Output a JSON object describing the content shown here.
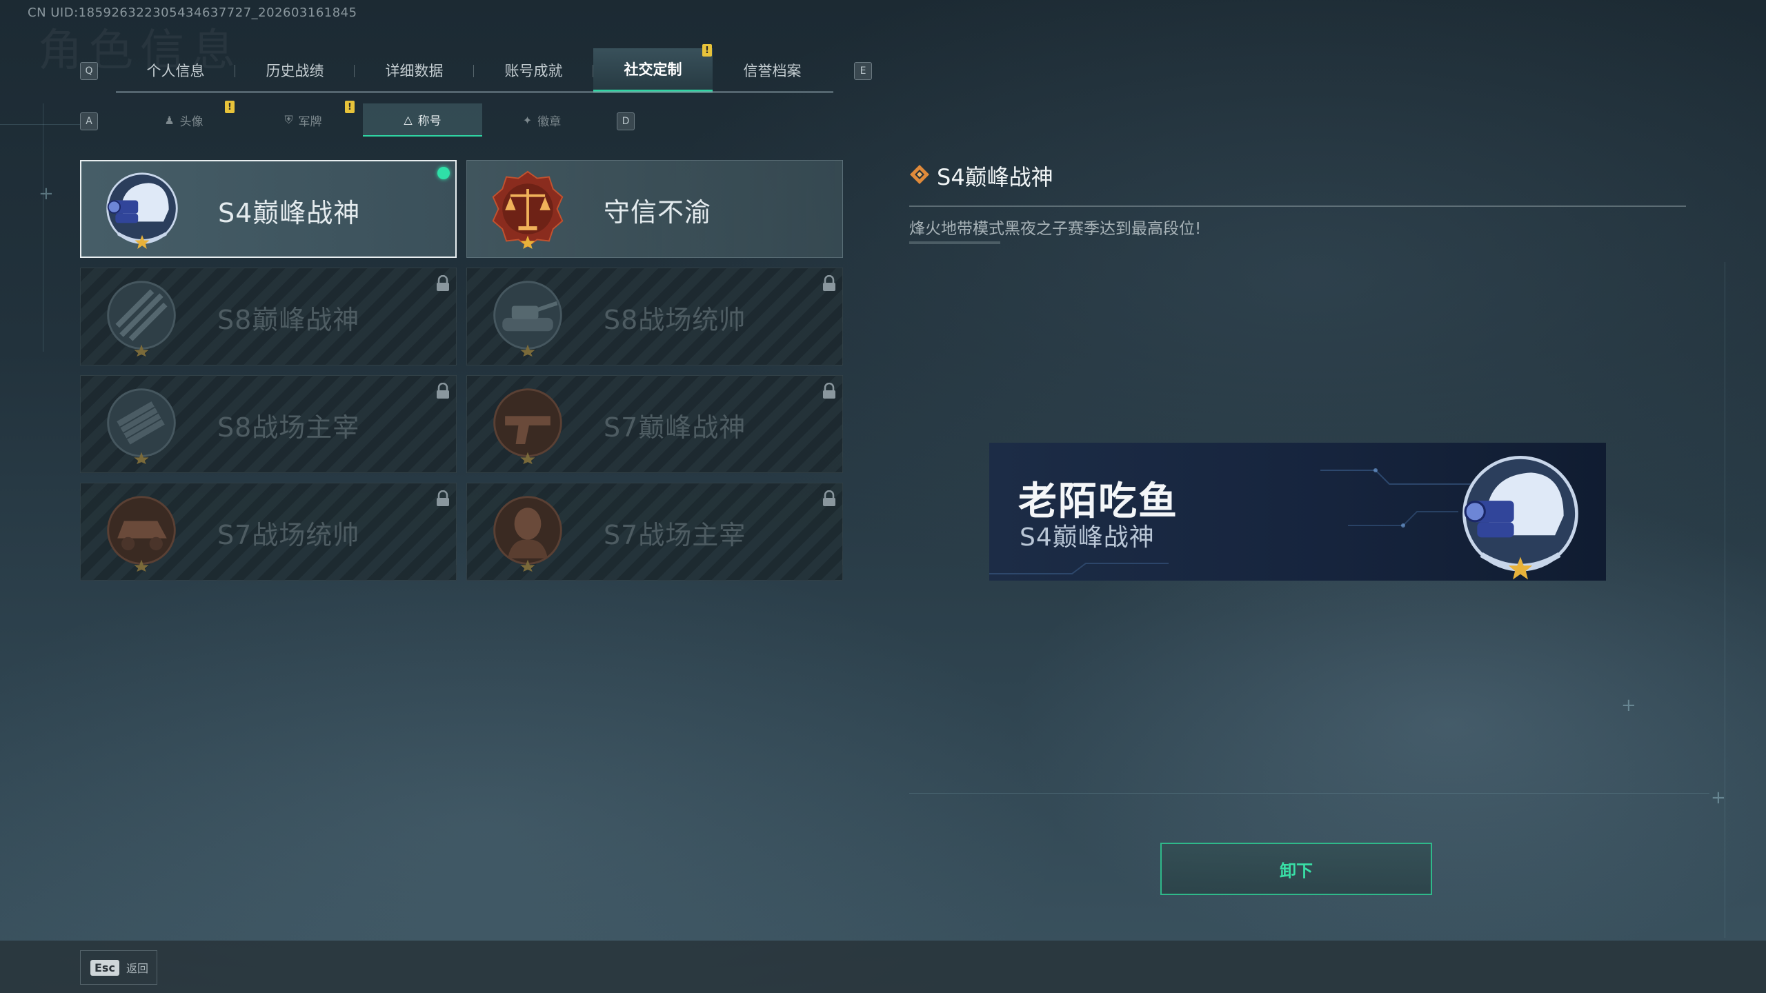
{
  "uid_text": "CN UID:185926322305434637727_202603161845",
  "page_bg_title": "角色信息",
  "keys": {
    "prev_main": "Q",
    "next_main": "E",
    "prev_sub": "A",
    "next_sub": "D"
  },
  "main_tabs": [
    "个人信息",
    "历史战绩",
    "详细数据",
    "账号成就",
    "社交定制",
    "信誉档案"
  ],
  "main_tab_active": "社交定制",
  "sub_tabs": [
    "头像",
    "军牌",
    "称号",
    "徽章"
  ],
  "sub_tab_active": "称号",
  "alert_mark": "!",
  "titles": [
    {
      "name": "S4巅峰战神",
      "state": "selected",
      "equipped": true,
      "badge": "helmet-nightvision"
    },
    {
      "name": "守信不渝",
      "state": "unlocked",
      "badge": "scales-of-justice"
    },
    {
      "name": "S8巅峰战神",
      "state": "locked",
      "badge": "crossed-blades"
    },
    {
      "name": "S8战场统帅",
      "state": "locked",
      "badge": "tank"
    },
    {
      "name": "S8战场主宰",
      "state": "locked",
      "badge": "rocket-launcher"
    },
    {
      "name": "S7巅峰战神",
      "state": "locked",
      "badge": "pistol"
    },
    {
      "name": "S7战场统帅",
      "state": "locked",
      "badge": "armored-vehicle"
    },
    {
      "name": "S7战场主宰",
      "state": "locked",
      "badge": "soldier-portrait"
    }
  ],
  "detail": {
    "title": "S4巅峰战神",
    "description": "烽火地带模式黑夜之子赛季达到最高段位!"
  },
  "namecard": {
    "player_name": "老陌吃鱼",
    "title": "S4巅峰战神"
  },
  "unequip_label": "卸下",
  "esc": {
    "key": "Esc",
    "label": "返回"
  },
  "colors": {
    "accent": "#2fd4a2",
    "alert": "#e8c33a",
    "equipped": "#2fe0a8"
  }
}
